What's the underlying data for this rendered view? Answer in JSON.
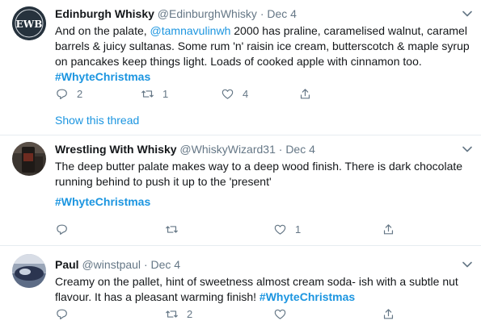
{
  "tweets": [
    {
      "author_name": "Edinburgh Whisky",
      "author_handle": "@EdinburghWhisky",
      "separator": "·",
      "date": "Dec 4",
      "avatar_text": "EWB",
      "text_a": "And on the palate, ",
      "mention": "@tamnavulinwh",
      "text_b": " 2000 has praline, caramelised walnut, caramel barrels & juicy sultanas. Some rum 'n' raisin ice cream, butterscotch & maple syrup on pancakes keep things light. Loads of cooked apple with cinnamon too.",
      "hashtag": "#WhyteChristmas",
      "reply_count": "2",
      "retweet_count": "1",
      "like_count": "4",
      "show_thread": "Show this thread"
    },
    {
      "author_name": "Wrestling With Whisky",
      "author_handle": "@WhiskyWizard31",
      "separator": "·",
      "date": "Dec 4",
      "text": "The deep butter palate makes way to a deep wood finish. There is dark chocolate running behind to push it up to the 'present'",
      "hashtag": "#WhyteChristmas",
      "reply_count": "",
      "retweet_count": "",
      "like_count": "1"
    },
    {
      "author_name": "Paul",
      "author_handle": "@winstpaul",
      "separator": "·",
      "date": "Dec 4",
      "text": "Creamy on the pallet, hint of sweetness almost cream soda- ish with a subtle nut flavour. It has a pleasant warming finish! ",
      "hashtag": "#WhyteChristmas",
      "reply_count": "",
      "retweet_count": "2"
    }
  ],
  "icons": {
    "reply": "reply-icon",
    "retweet": "retweet-icon",
    "like": "heart-icon",
    "share": "share-icon",
    "more": "chevron-down-icon"
  },
  "colors": {
    "link": "#1b95e0",
    "muted": "#657786",
    "text": "#14171a",
    "divider": "#e6ecf0"
  }
}
